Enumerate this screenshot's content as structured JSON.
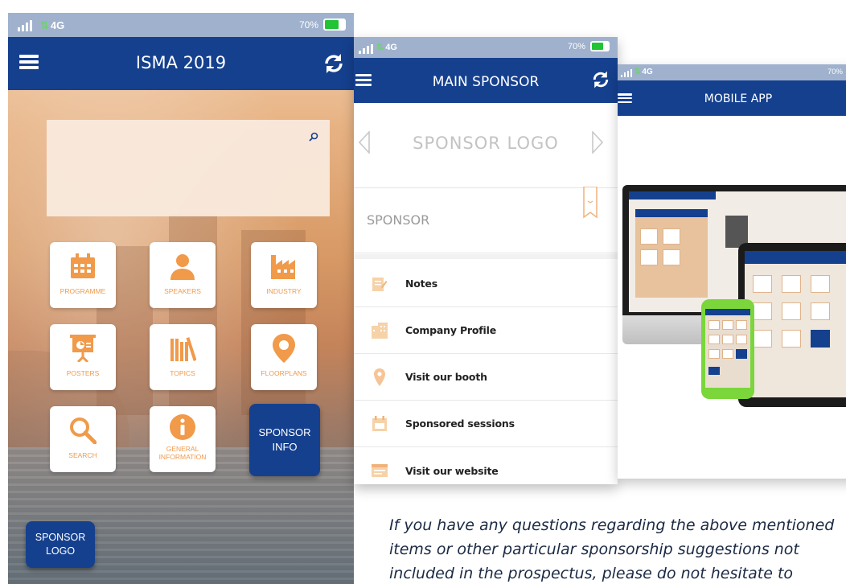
{
  "phone1": {
    "status": {
      "network": "4G",
      "battery": "70%"
    },
    "header": {
      "title": "ISMA 2019"
    },
    "tiles": [
      {
        "label": "PROGRAMME",
        "icon": "calendar-icon"
      },
      {
        "label": "SPEAKERS",
        "icon": "person-icon"
      },
      {
        "label": "INDUSTRY",
        "icon": "factory-icon"
      },
      {
        "label": "POSTERS",
        "icon": "presentation-icon"
      },
      {
        "label": "TOPICS",
        "icon": "books-icon"
      },
      {
        "label": "FLOORPLANS",
        "icon": "map-pin-icon"
      },
      {
        "label": "SEARCH",
        "icon": "magnifier-icon"
      },
      {
        "label": "GENERAL",
        "label2": "INFORMATION",
        "icon": "info-icon"
      }
    ],
    "sponsor_info": {
      "line1": "SPONSOR",
      "line2": "INFO"
    },
    "sponsor_logo": {
      "line1": "SPONSOR",
      "line2": "LOGO"
    }
  },
  "phone2": {
    "status": {
      "network": "4G",
      "battery": "70%"
    },
    "header": {
      "title": "MAIN SPONSOR"
    },
    "logo_text": "SPONSOR LOGO",
    "sponsor_text": "SPONSOR",
    "menu": [
      {
        "label": "Notes",
        "icon": "notes-icon"
      },
      {
        "label": "Company Profile",
        "icon": "building-icon"
      },
      {
        "label": "Visit our booth",
        "icon": "location-icon"
      },
      {
        "label": "Sponsored sessions",
        "icon": "calendar-icon"
      },
      {
        "label": "Visit our website",
        "icon": "browser-icon"
      }
    ]
  },
  "phone3": {
    "status": {
      "network": "4G",
      "battery": "70%"
    },
    "header": {
      "title": "MOBILE APP"
    }
  },
  "note": {
    "line1": "If you have any questions regarding the above mentioned",
    "line2": "items or other particular sponsorship suggestions not",
    "line3": "included in the prospectus, please do not hesitate to"
  },
  "colors": {
    "brand_blue": "#15408e",
    "status_bar": "#9fb1cd",
    "tile_accent": "#f09a4a"
  }
}
